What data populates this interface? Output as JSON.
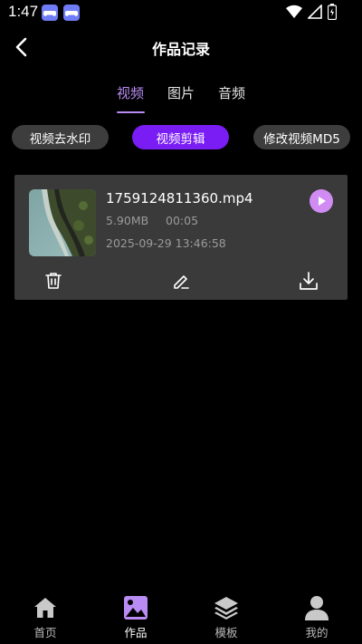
{
  "status": {
    "time": "1:47",
    "icons": [
      "game-controller-icon",
      "game-controller-icon",
      "wifi-icon",
      "signal-icon",
      "battery-icon"
    ]
  },
  "header": {
    "title": "作品记录",
    "back_icon": "chevron-left-icon"
  },
  "tabs": [
    {
      "label": "视频",
      "active": true
    },
    {
      "label": "图片",
      "active": false
    },
    {
      "label": "音频",
      "active": false
    }
  ],
  "filters": [
    {
      "label": "视频去水印",
      "active": false
    },
    {
      "label": "视频剪辑",
      "active": true
    },
    {
      "label": "修改视频MD5",
      "active": false
    }
  ],
  "items": [
    {
      "file_name": "1759124811360.mp4",
      "size": "5.90MB",
      "duration": "00:05",
      "date": "2025-09-29 13:46:58",
      "actions": [
        "trash-icon",
        "edit-icon",
        "download-icon"
      ]
    }
  ],
  "bottom_nav": [
    {
      "label": "首页",
      "icon": "home-icon",
      "active": false
    },
    {
      "label": "作品",
      "icon": "image-icon",
      "active": true
    },
    {
      "label": "模板",
      "icon": "layers-icon",
      "active": false
    },
    {
      "label": "我的",
      "icon": "user-icon",
      "active": false
    }
  ],
  "colors": {
    "accent": "#7a1cf4",
    "tab_active": "#b98cf3",
    "play": "#d18cf3",
    "card": "#3a3a3a",
    "pill": "#3d3d3d"
  }
}
